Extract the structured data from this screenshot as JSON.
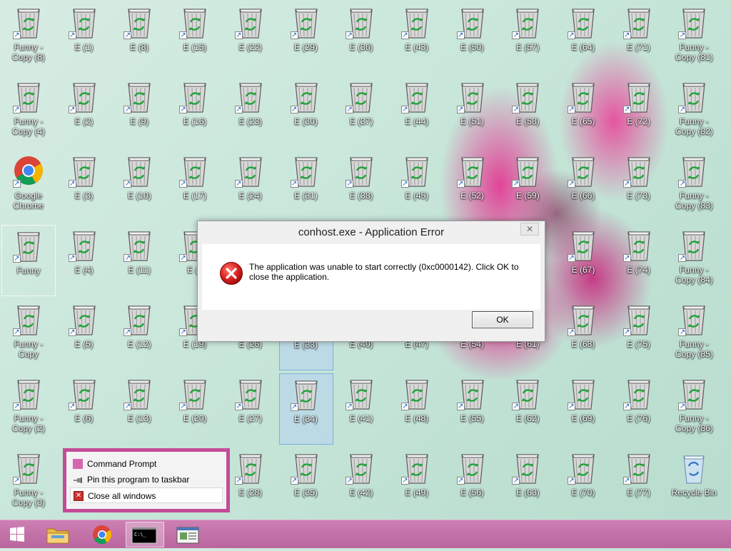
{
  "desktop": {
    "icon_type": "recycle-bin-shortcut-icon",
    "icons": [
      {
        "label": "Funny - Copy (8)",
        "col": 0,
        "row": 0,
        "type": "bin",
        "shortcut": true
      },
      {
        "label": "Funny - Copy (4)",
        "col": 0,
        "row": 1,
        "type": "bin",
        "shortcut": true
      },
      {
        "label": "Google Chrome",
        "col": 0,
        "row": 2,
        "type": "chrome",
        "shortcut": true
      },
      {
        "label": "Funny",
        "col": 0,
        "row": 3,
        "type": "bin",
        "shortcut": true,
        "focused": true
      },
      {
        "label": "Funny - Copy",
        "col": 0,
        "row": 4,
        "type": "bin",
        "shortcut": true
      },
      {
        "label": "Funny - Copy (2)",
        "col": 0,
        "row": 5,
        "type": "bin",
        "shortcut": true
      },
      {
        "label": "Funny - Copy (3)",
        "col": 0,
        "row": 6,
        "type": "bin",
        "shortcut": true
      },
      {
        "label": "E (1)",
        "col": 1,
        "row": 0,
        "type": "bin",
        "shortcut": true
      },
      {
        "label": "E (2)",
        "col": 1,
        "row": 1,
        "type": "bin",
        "shortcut": true
      },
      {
        "label": "E (3)",
        "col": 1,
        "row": 2,
        "type": "bin",
        "shortcut": true
      },
      {
        "label": "E (4)",
        "col": 1,
        "row": 3,
        "type": "bin",
        "shortcut": true
      },
      {
        "label": "E (5)",
        "col": 1,
        "row": 4,
        "type": "bin",
        "shortcut": true
      },
      {
        "label": "E (6)",
        "col": 1,
        "row": 5,
        "type": "bin",
        "shortcut": true
      },
      {
        "label": "E (8)",
        "col": 2,
        "row": 0,
        "type": "bin",
        "shortcut": true
      },
      {
        "label": "E (9)",
        "col": 2,
        "row": 1,
        "type": "bin",
        "shortcut": true
      },
      {
        "label": "E (10)",
        "col": 2,
        "row": 2,
        "type": "bin",
        "shortcut": true
      },
      {
        "label": "E (11)",
        "col": 2,
        "row": 3,
        "type": "bin",
        "shortcut": true
      },
      {
        "label": "E (12)",
        "col": 2,
        "row": 4,
        "type": "bin",
        "shortcut": true
      },
      {
        "label": "E (13)",
        "col": 2,
        "row": 5,
        "type": "bin",
        "shortcut": true
      },
      {
        "label": "E (15)",
        "col": 3,
        "row": 0,
        "type": "bin",
        "shortcut": true
      },
      {
        "label": "E (16)",
        "col": 3,
        "row": 1,
        "type": "bin",
        "shortcut": true
      },
      {
        "label": "E (17)",
        "col": 3,
        "row": 2,
        "type": "bin",
        "shortcut": true
      },
      {
        "label": "E (1",
        "col": 3,
        "row": 3,
        "type": "bin",
        "shortcut": true
      },
      {
        "label": "E (19)",
        "col": 3,
        "row": 4,
        "type": "bin",
        "shortcut": true
      },
      {
        "label": "E (20)",
        "col": 3,
        "row": 5,
        "type": "bin",
        "shortcut": true
      },
      {
        "label": "E (22)",
        "col": 4,
        "row": 0,
        "type": "bin",
        "shortcut": true
      },
      {
        "label": "E (23)",
        "col": 4,
        "row": 1,
        "type": "bin",
        "shortcut": true
      },
      {
        "label": "E (24)",
        "col": 4,
        "row": 2,
        "type": "bin",
        "shortcut": true
      },
      {
        "label": "E (26)",
        "col": 4,
        "row": 4,
        "type": "bin",
        "shortcut": true
      },
      {
        "label": "E (27)",
        "col": 4,
        "row": 5,
        "type": "bin",
        "shortcut": true
      },
      {
        "label": "E (28)",
        "col": 4,
        "row": 6,
        "type": "bin",
        "shortcut": true
      },
      {
        "label": "E (29)",
        "col": 5,
        "row": 0,
        "type": "bin",
        "shortcut": true
      },
      {
        "label": "E (30)",
        "col": 5,
        "row": 1,
        "type": "bin",
        "shortcut": true
      },
      {
        "label": "E (31)",
        "col": 5,
        "row": 2,
        "type": "bin",
        "shortcut": true
      },
      {
        "label": "E (33)",
        "col": 5,
        "row": 4,
        "type": "bin",
        "shortcut": true,
        "selected": true
      },
      {
        "label": "E (34)",
        "col": 5,
        "row": 5,
        "type": "bin",
        "shortcut": true,
        "selected": true
      },
      {
        "label": "E (35)",
        "col": 5,
        "row": 6,
        "type": "bin",
        "shortcut": true
      },
      {
        "label": "E (36)",
        "col": 6,
        "row": 0,
        "type": "bin",
        "shortcut": true
      },
      {
        "label": "E (37)",
        "col": 6,
        "row": 1,
        "type": "bin",
        "shortcut": true
      },
      {
        "label": "E (38)",
        "col": 6,
        "row": 2,
        "type": "bin",
        "shortcut": true
      },
      {
        "label": "E (40)",
        "col": 6,
        "row": 4,
        "type": "bin",
        "shortcut": true
      },
      {
        "label": "E (41)",
        "col": 6,
        "row": 5,
        "type": "bin",
        "shortcut": true
      },
      {
        "label": "E (42)",
        "col": 6,
        "row": 6,
        "type": "bin",
        "shortcut": true
      },
      {
        "label": "E (43)",
        "col": 7,
        "row": 0,
        "type": "bin",
        "shortcut": true
      },
      {
        "label": "E (44)",
        "col": 7,
        "row": 1,
        "type": "bin",
        "shortcut": true
      },
      {
        "label": "E (45)",
        "col": 7,
        "row": 2,
        "type": "bin",
        "shortcut": true
      },
      {
        "label": "E (47)",
        "col": 7,
        "row": 4,
        "type": "bin",
        "shortcut": true
      },
      {
        "label": "E (48)",
        "col": 7,
        "row": 5,
        "type": "bin",
        "shortcut": true
      },
      {
        "label": "E (49)",
        "col": 7,
        "row": 6,
        "type": "bin",
        "shortcut": true
      },
      {
        "label": "E (50)",
        "col": 8,
        "row": 0,
        "type": "bin",
        "shortcut": true
      },
      {
        "label": "E (51)",
        "col": 8,
        "row": 1,
        "type": "bin",
        "shortcut": true
      },
      {
        "label": "E (52)",
        "col": 8,
        "row": 2,
        "type": "bin",
        "shortcut": true
      },
      {
        "label": "E (54)",
        "col": 8,
        "row": 4,
        "type": "bin",
        "shortcut": true
      },
      {
        "label": "E (55)",
        "col": 8,
        "row": 5,
        "type": "bin",
        "shortcut": true
      },
      {
        "label": "E (56)",
        "col": 8,
        "row": 6,
        "type": "bin",
        "shortcut": true
      },
      {
        "label": "E (57)",
        "col": 9,
        "row": 0,
        "type": "bin",
        "shortcut": true
      },
      {
        "label": "E (58)",
        "col": 9,
        "row": 1,
        "type": "bin",
        "shortcut": true
      },
      {
        "label": "E (59)",
        "col": 9,
        "row": 2,
        "type": "bin",
        "shortcut": true
      },
      {
        "label": "E (61)",
        "col": 9,
        "row": 4,
        "type": "bin",
        "shortcut": true
      },
      {
        "label": "E (62)",
        "col": 9,
        "row": 5,
        "type": "bin",
        "shortcut": true
      },
      {
        "label": "E (63)",
        "col": 9,
        "row": 6,
        "type": "bin",
        "shortcut": true
      },
      {
        "label": "E (64)",
        "col": 10,
        "row": 0,
        "type": "bin",
        "shortcut": true
      },
      {
        "label": "E (65)",
        "col": 10,
        "row": 1,
        "type": "bin",
        "shortcut": true
      },
      {
        "label": "E (66)",
        "col": 10,
        "row": 2,
        "type": "bin",
        "shortcut": true
      },
      {
        "label": "E (67)",
        "col": 10,
        "row": 3,
        "type": "bin",
        "shortcut": true
      },
      {
        "label": "E (68)",
        "col": 10,
        "row": 4,
        "type": "bin",
        "shortcut": true
      },
      {
        "label": "E (69)",
        "col": 10,
        "row": 5,
        "type": "bin",
        "shortcut": true
      },
      {
        "label": "E (70)",
        "col": 10,
        "row": 6,
        "type": "bin",
        "shortcut": true
      },
      {
        "label": "E (71)",
        "col": 11,
        "row": 0,
        "type": "bin",
        "shortcut": true
      },
      {
        "label": "E (72)",
        "col": 11,
        "row": 1,
        "type": "bin",
        "shortcut": true
      },
      {
        "label": "E (73)",
        "col": 11,
        "row": 2,
        "type": "bin",
        "shortcut": true
      },
      {
        "label": "E (74)",
        "col": 11,
        "row": 3,
        "type": "bin",
        "shortcut": true
      },
      {
        "label": "E (75)",
        "col": 11,
        "row": 4,
        "type": "bin",
        "shortcut": true
      },
      {
        "label": "E (76)",
        "col": 11,
        "row": 5,
        "type": "bin",
        "shortcut": true
      },
      {
        "label": "E (77)",
        "col": 11,
        "row": 6,
        "type": "bin",
        "shortcut": true
      },
      {
        "label": "Funny - Copy (81)",
        "col": 12,
        "row": 0,
        "type": "bin",
        "shortcut": true
      },
      {
        "label": "Funny - Copy (82)",
        "col": 12,
        "row": 1,
        "type": "bin",
        "shortcut": true
      },
      {
        "label": "Funny - Copy (83)",
        "col": 12,
        "row": 2,
        "type": "bin",
        "shortcut": true
      },
      {
        "label": "Funny - Copy (84)",
        "col": 12,
        "row": 3,
        "type": "bin",
        "shortcut": true
      },
      {
        "label": "Funny - Copy (85)",
        "col": 12,
        "row": 4,
        "type": "bin",
        "shortcut": true
      },
      {
        "label": "Funny - Copy (86)",
        "col": 12,
        "row": 5,
        "type": "bin",
        "shortcut": true
      },
      {
        "label": "Recycle Bin",
        "col": 12,
        "row": 6,
        "type": "recycle",
        "shortcut": false
      }
    ]
  },
  "dialog": {
    "title": "conhost.exe - Application Error",
    "close_label": "✕",
    "icon": "error-icon",
    "message": "The application was unable to start correctly (0xc0000142). Click OK to close the application.",
    "ok_label": "OK"
  },
  "jumplist": {
    "items": [
      {
        "label": "Command Prompt",
        "icon": "command-prompt-icon"
      },
      {
        "label": "Pin this program to taskbar",
        "icon": "pin-icon"
      },
      {
        "label": "Close all windows",
        "icon": "close-windows-icon"
      }
    ]
  },
  "taskbar": {
    "buttons": [
      {
        "name": "start-button",
        "icon": "windows-logo-icon"
      },
      {
        "name": "file-explorer-button",
        "icon": "folder-icon"
      },
      {
        "name": "chrome-taskbar-button",
        "icon": "chrome-icon"
      },
      {
        "name": "command-prompt-taskbar-button",
        "icon": "command-prompt-icon",
        "active": true
      },
      {
        "name": "application-window-taskbar-button",
        "icon": "window-icon"
      }
    ]
  },
  "colors": {
    "taskbar": "#c06aa2",
    "jumplist_border": "#c34c96",
    "error_red": "#d9201f",
    "shortcut_arrow": "#1b62c9"
  }
}
